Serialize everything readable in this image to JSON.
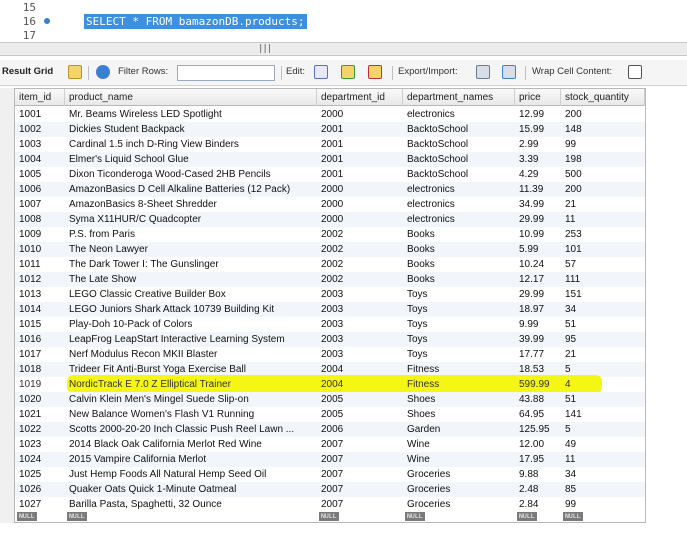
{
  "editor": {
    "lines": [
      {
        "num": "15",
        "code": "",
        "marker": false
      },
      {
        "num": "16",
        "code": "SELECT * FROM bamazonDB.products;",
        "marker": true
      },
      {
        "num": "17",
        "code": "",
        "marker": false
      }
    ]
  },
  "splitter": {
    "grip": "|||"
  },
  "toolbar": {
    "result_grid_label": "Result Grid",
    "filter_rows_label": "Filter Rows:",
    "filter_rows_value": "",
    "edit_label": "Edit:",
    "export_import_label": "Export/Import:",
    "wrap_cell_label": "Wrap Cell Content:"
  },
  "colors": {
    "selection": "#3d8fe0",
    "highlight": "#f5f500",
    "row_alt": "#f2f6fb"
  },
  "grid": {
    "columns": [
      "item_id",
      "product_name",
      "department_id",
      "department_names",
      "price",
      "stock_quantity"
    ],
    "rows": [
      [
        "1001",
        "Mr. Beams Wireless LED Spotlight",
        "2000",
        "electronics",
        "12.99",
        "200"
      ],
      [
        "1002",
        "Dickies Student Backpack",
        "2001",
        "BacktoSchool",
        "15.99",
        "148"
      ],
      [
        "1003",
        "Cardinal 1.5 inch D-Ring View Binders",
        "2001",
        "BacktoSchool",
        "2.99",
        "99"
      ],
      [
        "1004",
        "Elmer's Liquid School Glue",
        "2001",
        "BacktoSchool",
        "3.39",
        "198"
      ],
      [
        "1005",
        "Dixon Ticonderoga Wood-Cased 2HB Pencils",
        "2001",
        "BacktoSchool",
        "4.29",
        "500"
      ],
      [
        "1006",
        "AmazonBasics D Cell Alkaline Batteries (12 Pack)",
        "2000",
        "electronics",
        "11.39",
        "200"
      ],
      [
        "1007",
        "AmazonBasics 8-Sheet Shredder",
        "2000",
        "electronics",
        "34.99",
        "21"
      ],
      [
        "1008",
        "Syma X11HUR/C Quadcopter",
        "2000",
        "electronics",
        "29.99",
        "11"
      ],
      [
        "1009",
        "P.S. from Paris",
        "2002",
        "Books",
        "10.99",
        "253"
      ],
      [
        "1010",
        "The Neon Lawyer",
        "2002",
        "Books",
        "5.99",
        "101"
      ],
      [
        "1011",
        "The Dark Tower I: The Gunslinger",
        "2002",
        "Books",
        "10.24",
        "57"
      ],
      [
        "1012",
        "The Late Show",
        "2002",
        "Books",
        "12.17",
        "111"
      ],
      [
        "1013",
        "LEGO Classic Creative Builder Box",
        "2003",
        "Toys",
        "29.99",
        "151"
      ],
      [
        "1014",
        "LEGO Juniors Shark Attack 10739 Building Kit",
        "2003",
        "Toys",
        "18.97",
        "34"
      ],
      [
        "1015",
        "Play-Doh 10-Pack of Colors",
        "2003",
        "Toys",
        "9.99",
        "51"
      ],
      [
        "1016",
        "LeapFrog LeapStart Interactive Learning System",
        "2003",
        "Toys",
        "39.99",
        "95"
      ],
      [
        "1017",
        "Nerf Modulus Recon MKII Blaster",
        "2003",
        "Toys",
        "17.77",
        "21"
      ],
      [
        "1018",
        "Trideer Fit Anti-Burst Yoga Exercise Ball",
        "2004",
        "Fitness",
        "18.53",
        "5"
      ],
      [
        "1019",
        "NordicTrack E 7.0 Z Elliptical Trainer",
        "2004",
        "Fitness",
        "599.99",
        "4"
      ],
      [
        "1020",
        "Calvin Klein Men's Mingel Suede Slip-on",
        "2005",
        "Shoes",
        "43.88",
        "51"
      ],
      [
        "1021",
        "New Balance Women's Flash V1 Running",
        "2005",
        "Shoes",
        "64.95",
        "141"
      ],
      [
        "1022",
        "Scotts 2000-20-20 Inch Classic Push Reel Lawn ...",
        "2006",
        "Garden",
        "125.95",
        "5"
      ],
      [
        "1023",
        "2014 Black Oak California Merlot Red Wine",
        "2007",
        "Wine",
        "12.00",
        "49"
      ],
      [
        "1024",
        "2015 Vampire California Merlot",
        "2007",
        "Wine",
        "17.95",
        "11"
      ],
      [
        "1025",
        "Just Hemp Foods All Natural Hemp Seed Oil",
        "2007",
        "Groceries",
        "9.88",
        "34"
      ],
      [
        "1026",
        "Quaker Oats Quick 1-Minute Oatmeal",
        "2007",
        "Groceries",
        "2.48",
        "85"
      ],
      [
        "1027",
        "Barilla Pasta, Spaghetti, 32 Ounce",
        "2007",
        "Groceries",
        "2.84",
        "99"
      ]
    ],
    "highlighted_row": 18,
    "null_labels": [
      "NULL",
      "NULL",
      "NULL",
      "NULL",
      "NULL",
      "NULL"
    ]
  }
}
